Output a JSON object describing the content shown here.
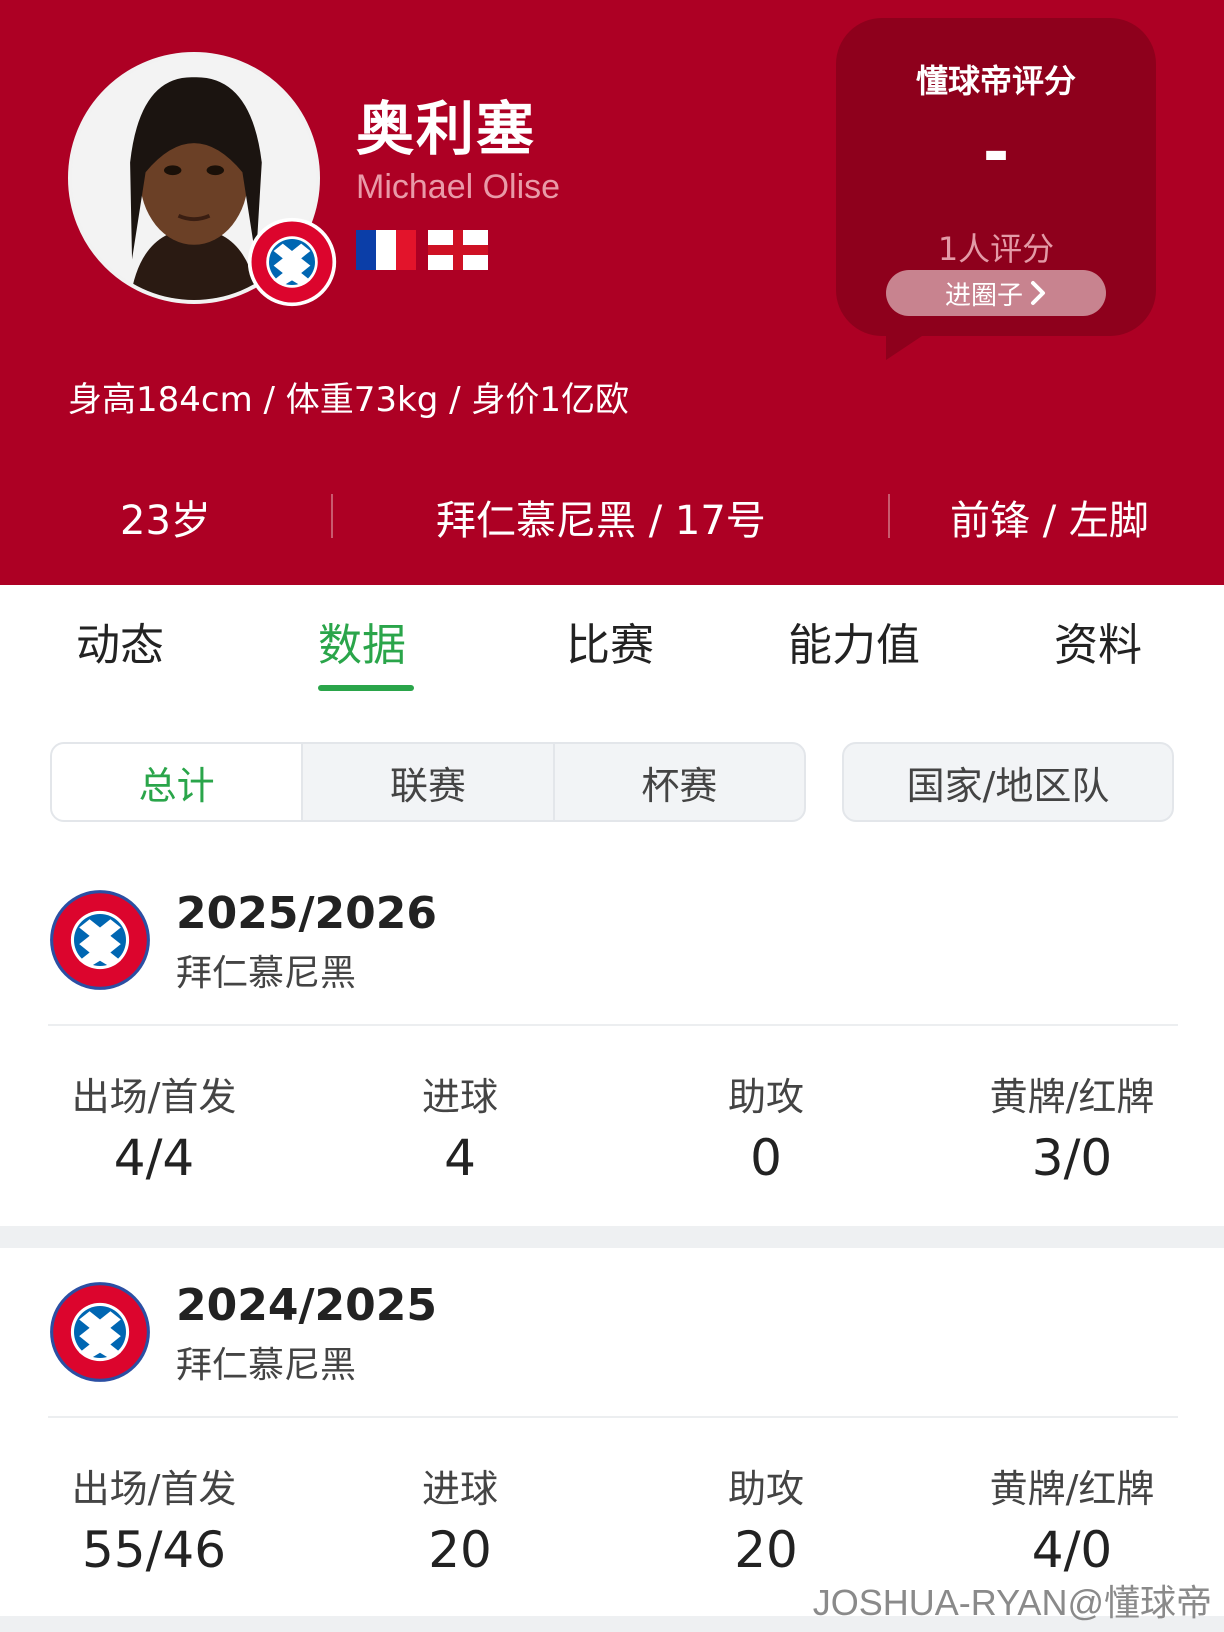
{
  "player": {
    "name_cn": "奥利塞",
    "name_en": "Michael Olise",
    "flags": [
      "france-flag",
      "england-flag"
    ],
    "bio": "身高184cm / 体重73kg / 身价1亿欧",
    "age": "23岁",
    "team_number": "拜仁慕尼黑 / 17号",
    "position_foot": "前锋 / 左脚"
  },
  "rating": {
    "title": "懂球帝评分",
    "value": "-",
    "count": "1人评分",
    "join_label": "进圈子",
    "join_icon": "chevron-right-icon"
  },
  "tabs": [
    {
      "label": "动态"
    },
    {
      "label": "数据",
      "active": true
    },
    {
      "label": "比赛"
    },
    {
      "label": "能力值"
    },
    {
      "label": "资料"
    }
  ],
  "segments": {
    "items": [
      {
        "label": "总计",
        "active": true
      },
      {
        "label": "联赛"
      },
      {
        "label": "杯赛"
      }
    ],
    "national": "国家/地区队"
  },
  "seasons": [
    {
      "year": "2025/2026",
      "club": "拜仁慕尼黑",
      "stats": [
        {
          "label": "出场/首发",
          "value": "4/4"
        },
        {
          "label": "进球",
          "value": "4"
        },
        {
          "label": "助攻",
          "value": "0"
        },
        {
          "label": "黄牌/红牌",
          "value": "3/0"
        }
      ]
    },
    {
      "year": "2024/2025",
      "club": "拜仁慕尼黑",
      "stats": [
        {
          "label": "出场/首发",
          "value": "55/46"
        },
        {
          "label": "进球",
          "value": "20"
        },
        {
          "label": "助攻",
          "value": "20"
        },
        {
          "label": "黄牌/红牌",
          "value": "4/0"
        }
      ]
    }
  ],
  "watermark": "JOSHUA-RYAN@懂球帝",
  "colors": {
    "header_red": "#ad0024",
    "rating_bubble": "#8e001c",
    "accent_green": "#2aa54a"
  }
}
